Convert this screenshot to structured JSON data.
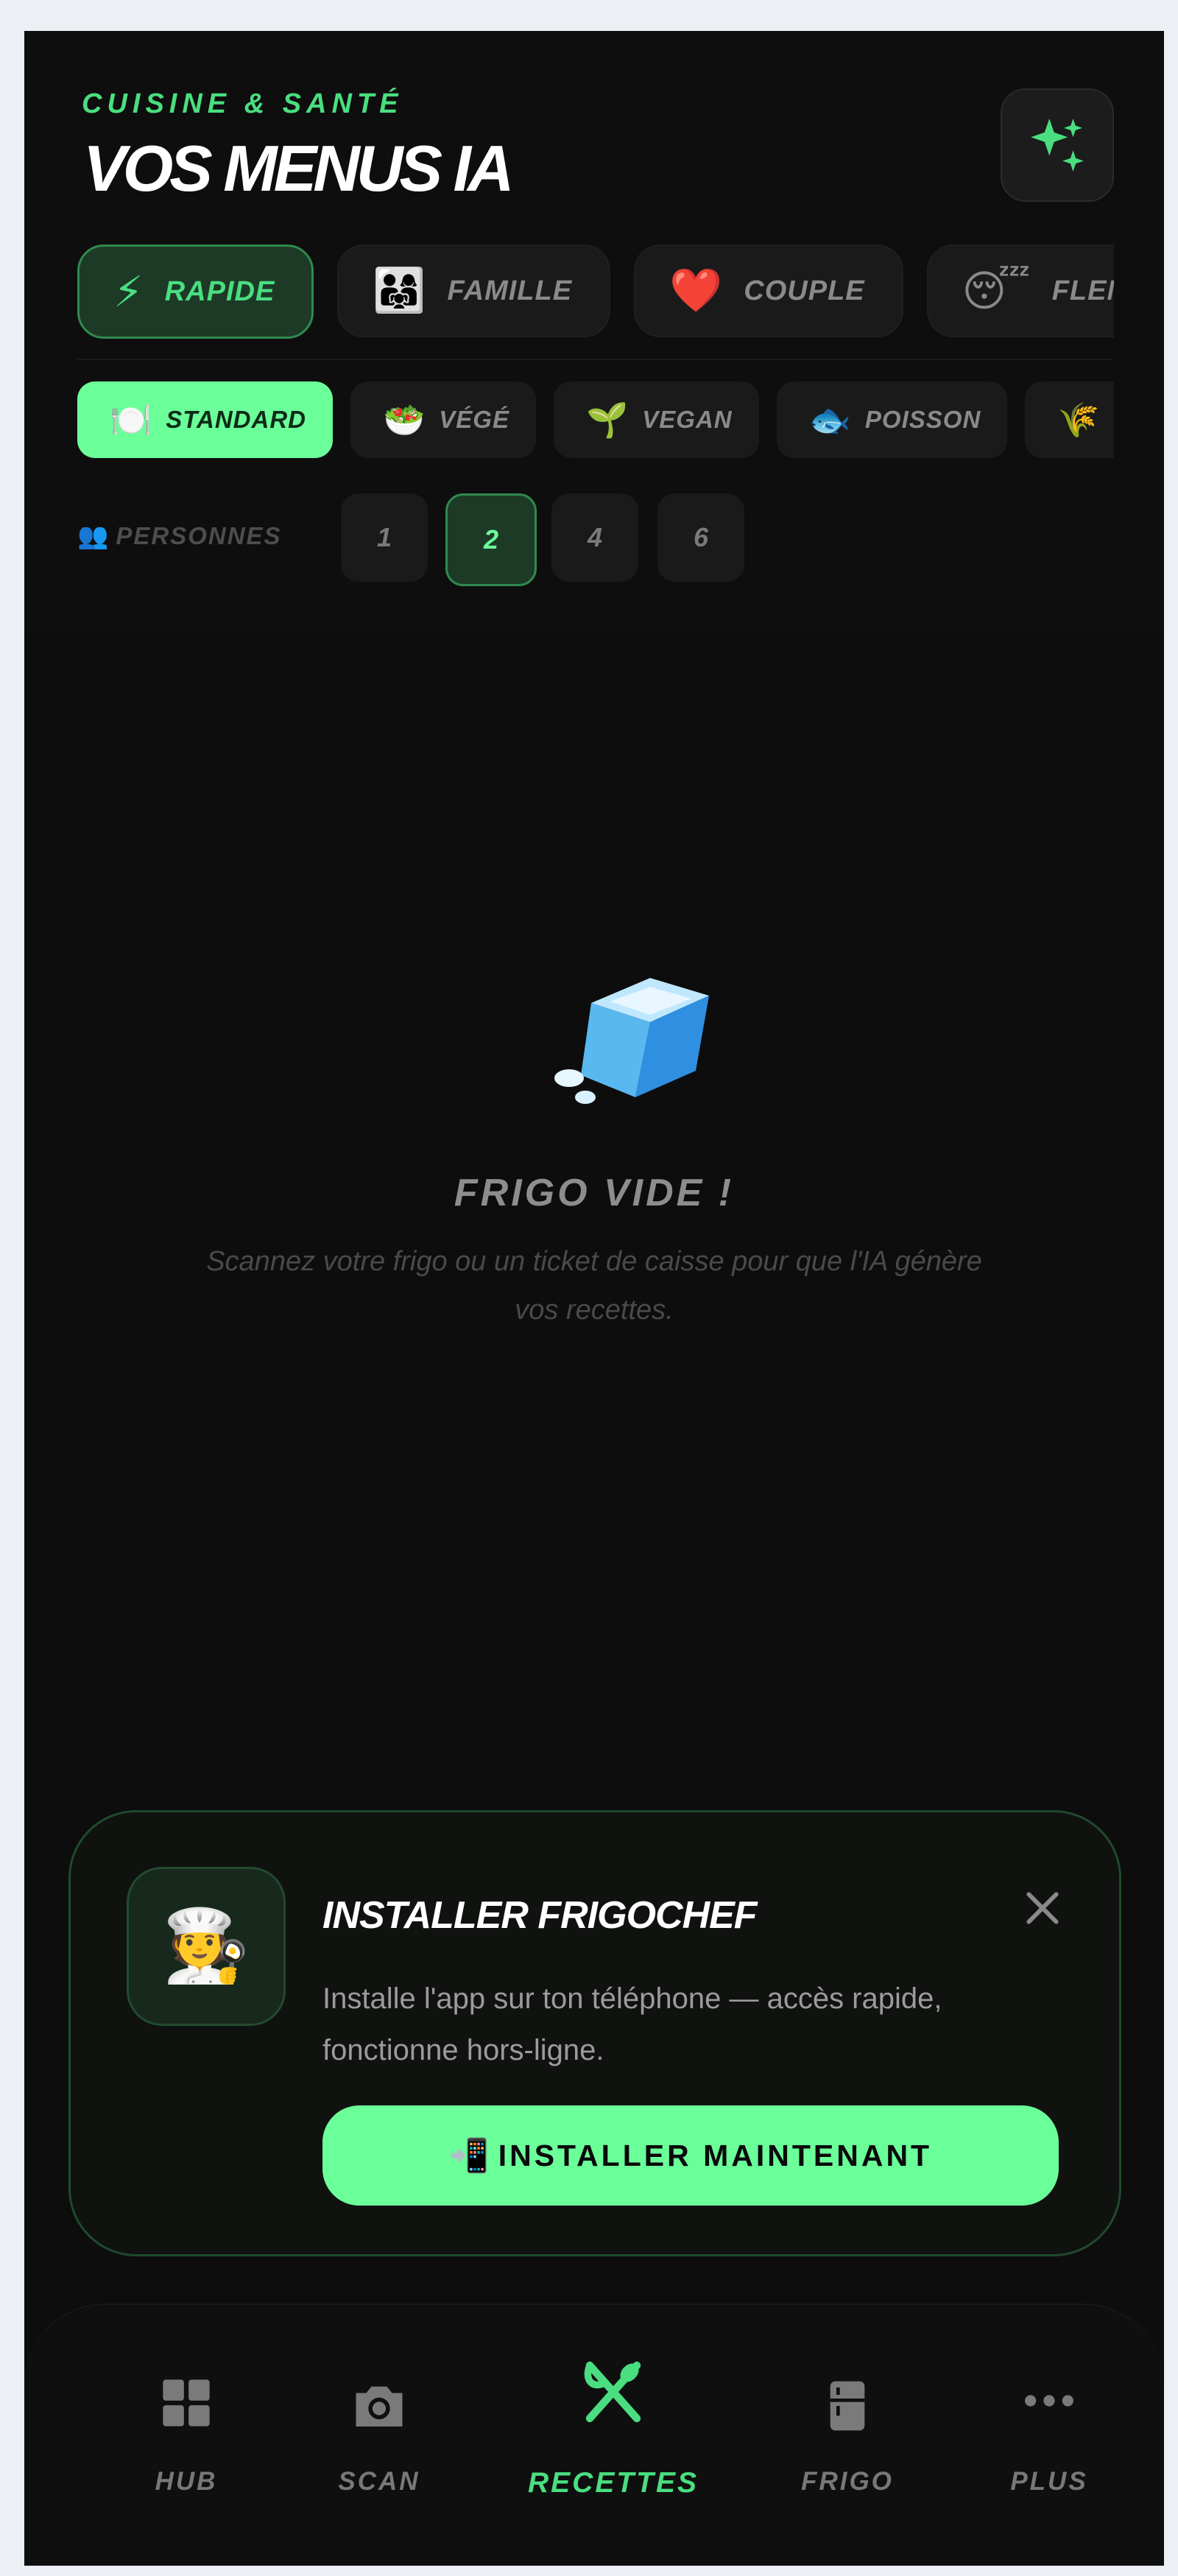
{
  "header": {
    "eyebrow": "CUISINE & SANTÉ",
    "title": "VOS MENUS IA",
    "magic_icon": "sparkles-icon"
  },
  "modes": [
    {
      "emoji": "⚡",
      "label": "RAPIDE",
      "active": true
    },
    {
      "emoji": "👨‍👩‍👧",
      "label": "FAMILLE",
      "active": false
    },
    {
      "emoji": "❤️",
      "label": "COUPLE",
      "active": false
    },
    {
      "emoji": "😴",
      "label": "FLEMME",
      "active": false
    }
  ],
  "diets": [
    {
      "emoji": "🍽️",
      "label": "STANDARD",
      "active": true
    },
    {
      "emoji": "🥗",
      "label": "VÉGÉ",
      "active": false
    },
    {
      "emoji": "🌱",
      "label": "VEGAN",
      "active": false
    },
    {
      "emoji": "🐟",
      "label": "POISSON",
      "active": false
    },
    {
      "emoji": "🌾",
      "label": "",
      "active": false
    }
  ],
  "persons": {
    "emoji": "👥",
    "label": "PERSONNES",
    "options": [
      "1",
      "2",
      "4",
      "6"
    ],
    "selected": "2"
  },
  "empty_state": {
    "icon": "ice-cube-icon",
    "title": "FRIGO VIDE !",
    "subtitle": "Scannez votre frigo ou un ticket de caisse pour que l'IA génère vos recettes."
  },
  "install_card": {
    "icon": "chef-icon",
    "chef_emoji": "🧑‍🍳",
    "title": "INSTALLER FRIGOCHEF",
    "description": "Installe l'app sur ton téléphone — accès rapide, fonctionne hors-ligne.",
    "button_emoji": "📲",
    "button_label": "INSTALLER MAINTENANT"
  },
  "nav": {
    "items": [
      {
        "label": "HUB",
        "icon": "grid-icon"
      },
      {
        "label": "SCAN",
        "icon": "camera-icon"
      },
      {
        "label": "RECETTES",
        "icon": "utensils-icon",
        "active": true
      },
      {
        "label": "FRIGO",
        "icon": "fridge-icon"
      },
      {
        "label": "PLUS",
        "icon": "more-icon"
      }
    ]
  },
  "colors": {
    "accent": "#6bff9a",
    "accent_text": "#4ade80",
    "background": "#0d0d0d",
    "chip": "#1a1a1a",
    "chip_active_bg": "#1d3a27"
  }
}
